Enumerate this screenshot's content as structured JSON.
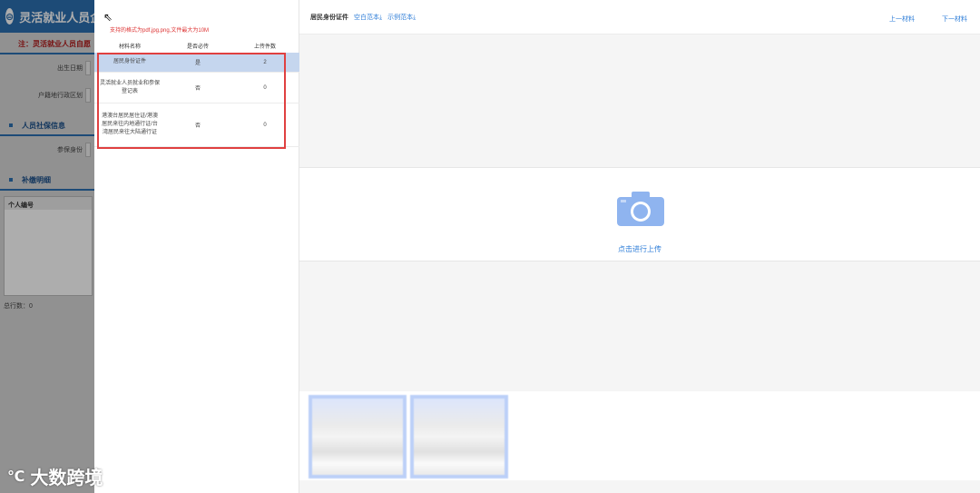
{
  "background": {
    "app_title": "灵活就业人员企",
    "logo_glyph": "⊜",
    "note_section": "注：灵活就业人员自愿",
    "fields": [
      "出生日期",
      "户籍地行政区划"
    ],
    "social_section": "人员社保信息",
    "social_field": "参保身份",
    "supplement_section": "补缴明细",
    "table_header": "个人编号",
    "total_label": "总行数：0"
  },
  "left": {
    "hint": "支持的格式为pdf,jpg,png,文件最大为10M",
    "columns": {
      "name": "材料名称",
      "required": "是否必传",
      "count": "上传件数"
    },
    "rows": [
      {
        "name": "居民身份证件",
        "required": "是",
        "count": "2",
        "active": true
      },
      {
        "name": "灵活就业人员就业和参保登记表",
        "required": "否",
        "count": "0",
        "active": false
      },
      {
        "name": "港澳台居民居住证/港澳居民来往内地通行证/台湾居民来往大陆通行证",
        "required": "否",
        "count": "0",
        "active": false
      }
    ]
  },
  "right": {
    "doc_title": "居民身份证件",
    "blank_template": "空白范本⤓",
    "sample_template": "示例范本⤓",
    "prev": "上一材料",
    "next": "下一材料",
    "upload_text": "点击进行上传"
  },
  "colors": {
    "accent": "#2f7ed8",
    "highlight_box": "#e04040",
    "active_row": "#c5d6ee"
  },
  "watermark": "大数跨境"
}
